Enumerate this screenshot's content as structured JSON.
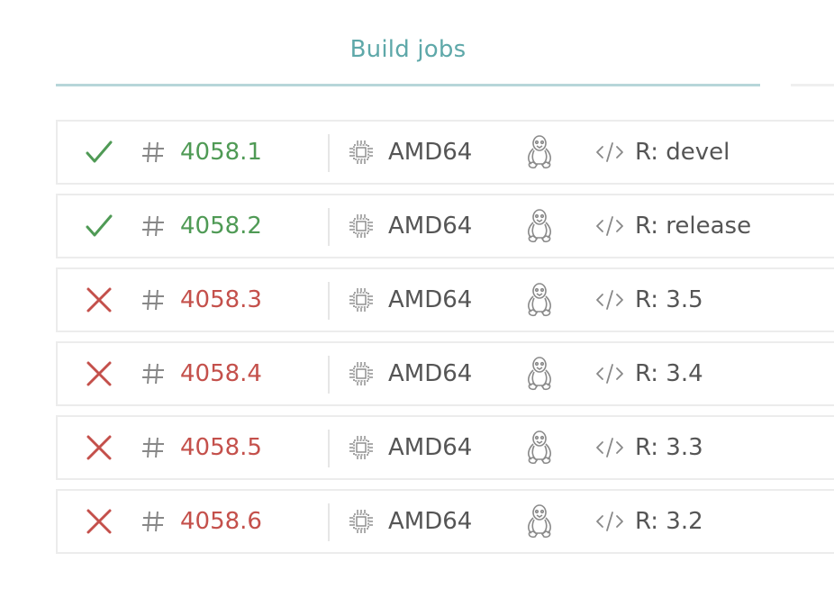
{
  "tabs": {
    "active_label": "Build jobs"
  },
  "colors": {
    "accent": "#5ea8a9",
    "tab_underline": "#b7d6d9",
    "success": "#4f9a55",
    "failure": "#c4504b",
    "text": "#555555",
    "icon": "#888888"
  },
  "jobs": [
    {
      "status": "passed",
      "status_icon": "check-icon",
      "number": "4058.1",
      "arch": "AMD64",
      "os_icon": "linux-tux-icon",
      "r_version": "R: devel"
    },
    {
      "status": "passed",
      "status_icon": "check-icon",
      "number": "4058.2",
      "arch": "AMD64",
      "os_icon": "linux-tux-icon",
      "r_version": "R: release"
    },
    {
      "status": "failed",
      "status_icon": "cross-icon",
      "number": "4058.3",
      "arch": "AMD64",
      "os_icon": "linux-tux-icon",
      "r_version": "R: 3.5"
    },
    {
      "status": "failed",
      "status_icon": "cross-icon",
      "number": "4058.4",
      "arch": "AMD64",
      "os_icon": "linux-tux-icon",
      "r_version": "R: 3.4"
    },
    {
      "status": "failed",
      "status_icon": "cross-icon",
      "number": "4058.5",
      "arch": "AMD64",
      "os_icon": "linux-tux-icon",
      "r_version": "R: 3.3"
    },
    {
      "status": "failed",
      "status_icon": "cross-icon",
      "number": "4058.6",
      "arch": "AMD64",
      "os_icon": "linux-tux-icon",
      "r_version": "R: 3.2"
    }
  ]
}
